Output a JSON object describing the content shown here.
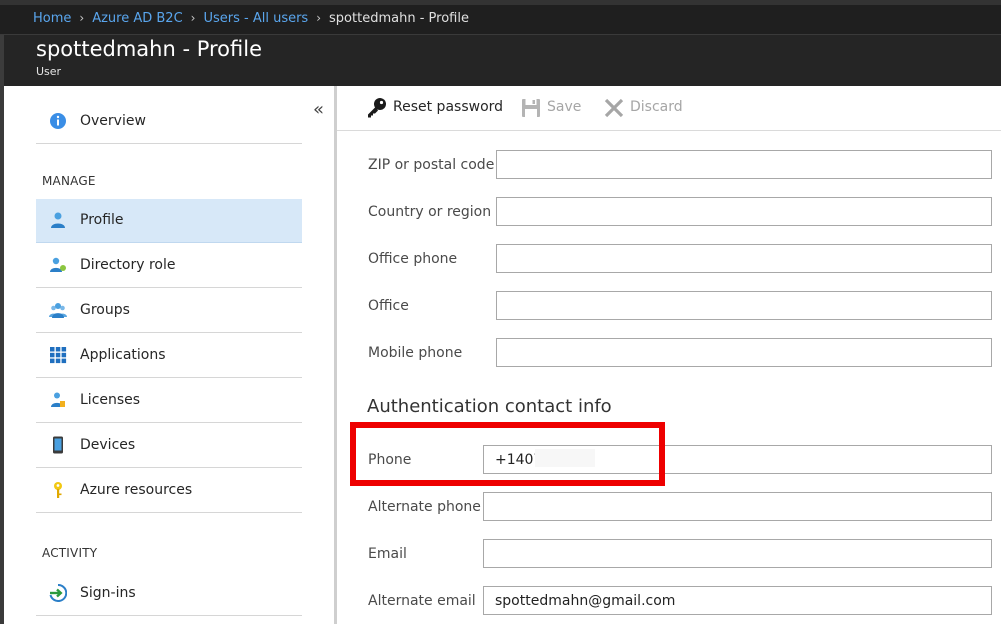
{
  "breadcrumb": [
    "Home",
    "Azure AD B2C",
    "Users - All users",
    "spottedmahn - Profile"
  ],
  "header": {
    "title": "spottedmahn - Profile",
    "subtitle": "User"
  },
  "sidebar": {
    "overview": "Overview",
    "manage_label": "MANAGE",
    "manage_items": [
      "Profile",
      "Directory role",
      "Groups",
      "Applications",
      "Licenses",
      "Devices",
      "Azure resources"
    ],
    "activity_label": "ACTIVITY",
    "activity_items": [
      "Sign-ins"
    ],
    "active_item": "Profile"
  },
  "toolbar": {
    "reset": "Reset password",
    "save": "Save",
    "discard": "Discard"
  },
  "form": {
    "fields": [
      {
        "label": "ZIP or postal code",
        "value": ""
      },
      {
        "label": "Country or region",
        "value": ""
      },
      {
        "label": "Office phone",
        "value": ""
      },
      {
        "label": "Office",
        "value": ""
      },
      {
        "label": "Mobile phone",
        "value": ""
      }
    ],
    "auth_heading": "Authentication contact info",
    "auth_fields": [
      {
        "label": "Phone",
        "value": "+1407"
      },
      {
        "label": "Alternate phone",
        "value": ""
      },
      {
        "label": "Email",
        "value": ""
      },
      {
        "label": "Alternate email",
        "value": "spottedmahn@gmail.com"
      }
    ]
  },
  "colors": {
    "accent": "#0078d4",
    "active_bg": "#d7e8f8",
    "highlight": "#ee0000",
    "header_bg": "#252525"
  }
}
